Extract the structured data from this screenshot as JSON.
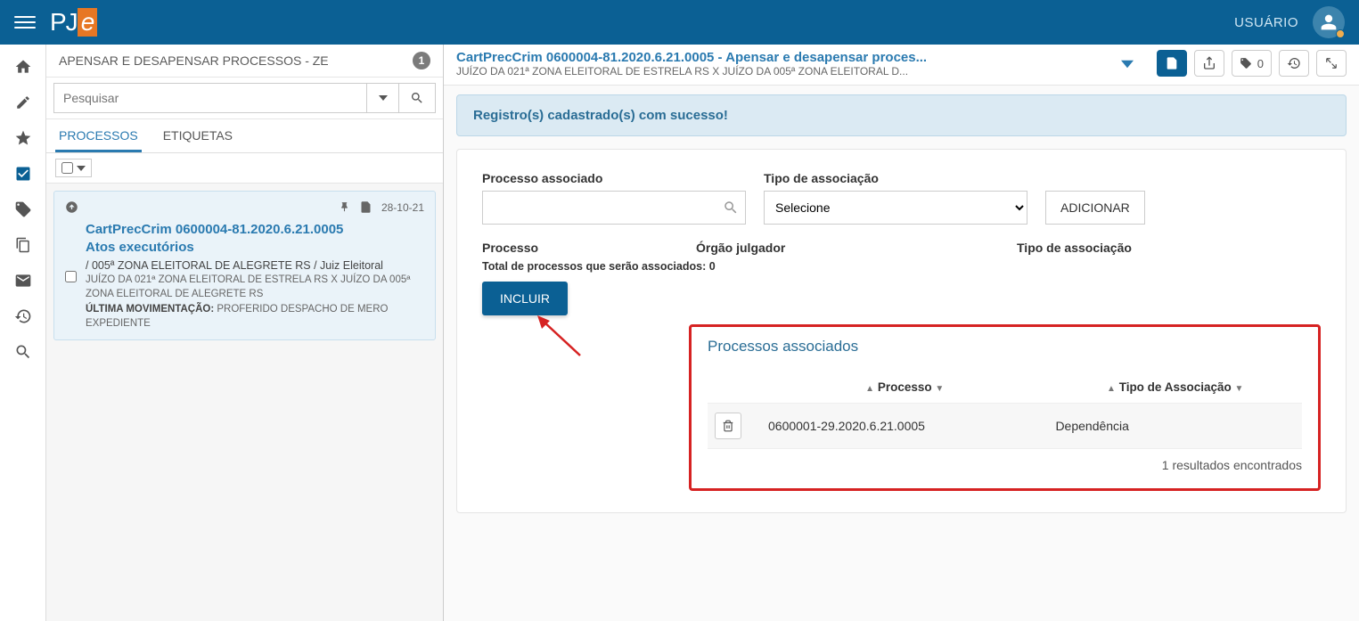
{
  "header": {
    "user_label": "USUÁRIO"
  },
  "logo": {
    "pj": "PJ",
    "e": "e"
  },
  "taskPanel": {
    "title": "APENSAR E DESAPENSAR PROCESSOS - ZE",
    "count": "1",
    "searchPlaceholder": "Pesquisar",
    "tabs": {
      "processos": "PROCESSOS",
      "etiquetas": "ETIQUETAS"
    },
    "card": {
      "date": "28-10-21",
      "title_line1": "CartPrecCrim 0600004-81.2020.6.21.0005",
      "title_line2": "Atos executórios",
      "sub": "/ 005ª ZONA ELEITORAL DE ALEGRETE RS / Juiz Eleitoral",
      "meta1": "JUÍZO DA 021ª ZONA ELEITORAL DE ESTRELA RS X JUÍZO DA 005ª ZONA ELEITORAL DE ALEGRETE RS",
      "meta2_label": "ÚLTIMA MOVIMENTAÇÃO:",
      "meta2_value": " PROFERIDO DESPACHO DE MERO EXPEDIENTE"
    }
  },
  "procHeader": {
    "title": "CartPrecCrim 0600004-81.2020.6.21.0005 - Apensar e desapensar proces...",
    "sub": "JUÍZO DA 021ª ZONA ELEITORAL DE ESTRELA RS X JUÍZO DA 005ª ZONA ELEITORAL D...",
    "tagCount": "0"
  },
  "alert": {
    "message": "Registro(s) cadastrado(s) com sucesso!"
  },
  "form": {
    "procLabel": "Processo associado",
    "tipoLabel": "Tipo de associação",
    "tipoPlaceholder": "Selecione",
    "addBtn": "ADICIONAR",
    "col1": "Processo",
    "col2": "Órgão julgador",
    "col3": "Tipo de associação",
    "totalLine": "Total de processos que serão associados: 0",
    "incluirBtn": "INCLUIR"
  },
  "assoc": {
    "title": "Processos associados",
    "th_proc": "Processo",
    "th_tipo": "Tipo de Associação",
    "row_proc": "0600001-29.2020.6.21.0005",
    "row_tipo": "Dependência",
    "results": "1 resultados encontrados"
  }
}
